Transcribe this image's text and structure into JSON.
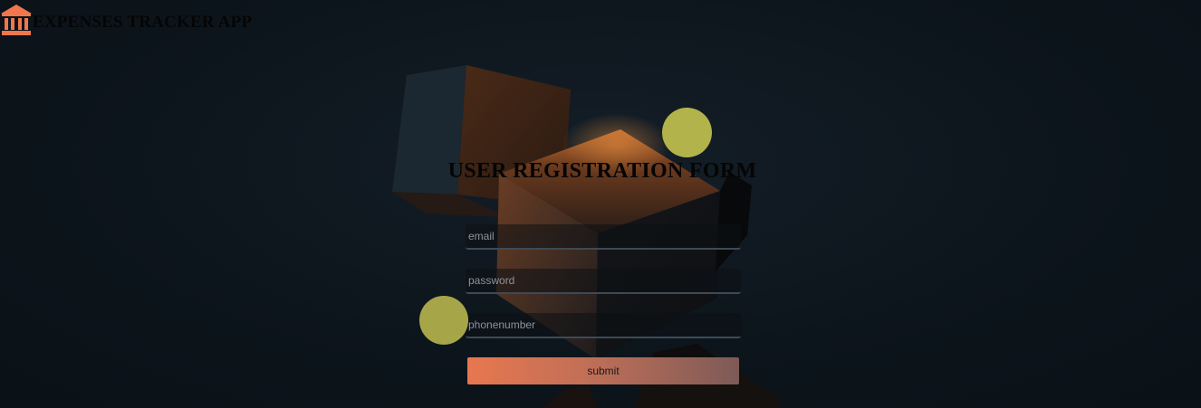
{
  "header": {
    "title": "EXPENSES TRACKER APP",
    "logo_icon": "bank-building-icon",
    "logo_color": "#f0764d"
  },
  "form": {
    "title": "USER REGISTRATION FORM",
    "email_placeholder": "email",
    "password_placeholder": "password",
    "phone_placeholder": "phonenumber",
    "submit_label": "submit"
  },
  "theme": {
    "background": "#0c141b",
    "accent": "#e8774f",
    "orb_color": "#b3b34c"
  }
}
